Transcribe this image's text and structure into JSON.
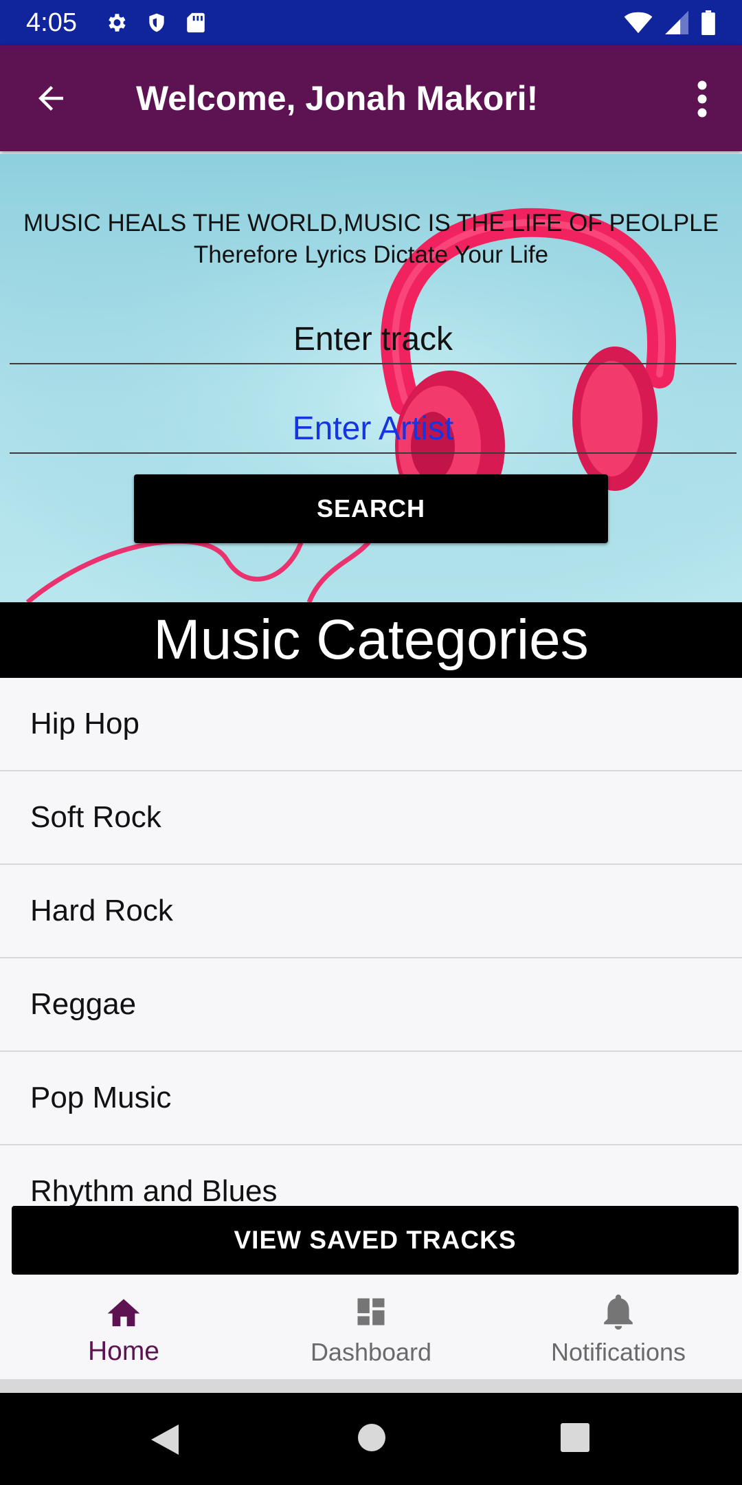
{
  "status_bar": {
    "time": "4:05",
    "left_icons": [
      "gear-icon",
      "shield-icon",
      "sd-card-icon"
    ],
    "right_icons": [
      "wifi-icon",
      "signal-icon",
      "battery-icon"
    ],
    "background": "#10249b"
  },
  "app_bar": {
    "title": "Welcome, Jonah Makori!",
    "background": "#5d1252"
  },
  "hero": {
    "slogan_line1": "MUSIC HEALS THE WORLD,MUSIC IS THE LIFE OF PEOLPLE",
    "slogan_line2": "Therefore Lyrics Dictate Your Life",
    "track_placeholder": "Enter track",
    "artist_placeholder": "Enter Artist",
    "search_label": "SEARCH"
  },
  "categories": {
    "header": "Music Categories",
    "items": [
      "Hip Hop",
      "Soft Rock",
      "Hard Rock",
      "Reggae",
      "Pop Music",
      "Rhythm and Blues"
    ]
  },
  "saved_button": {
    "label": "VIEW SAVED TRACKS"
  },
  "bottom_nav": {
    "items": [
      {
        "label": "Home",
        "icon": "home-icon",
        "active": true
      },
      {
        "label": "Dashboard",
        "icon": "dashboard-icon",
        "active": false
      },
      {
        "label": "Notifications",
        "icon": "bell-icon",
        "active": false
      }
    ],
    "active_color": "#5d1252"
  },
  "system_nav": {
    "buttons": [
      "back-triangle-icon",
      "home-circle-icon",
      "recents-square-icon"
    ]
  }
}
